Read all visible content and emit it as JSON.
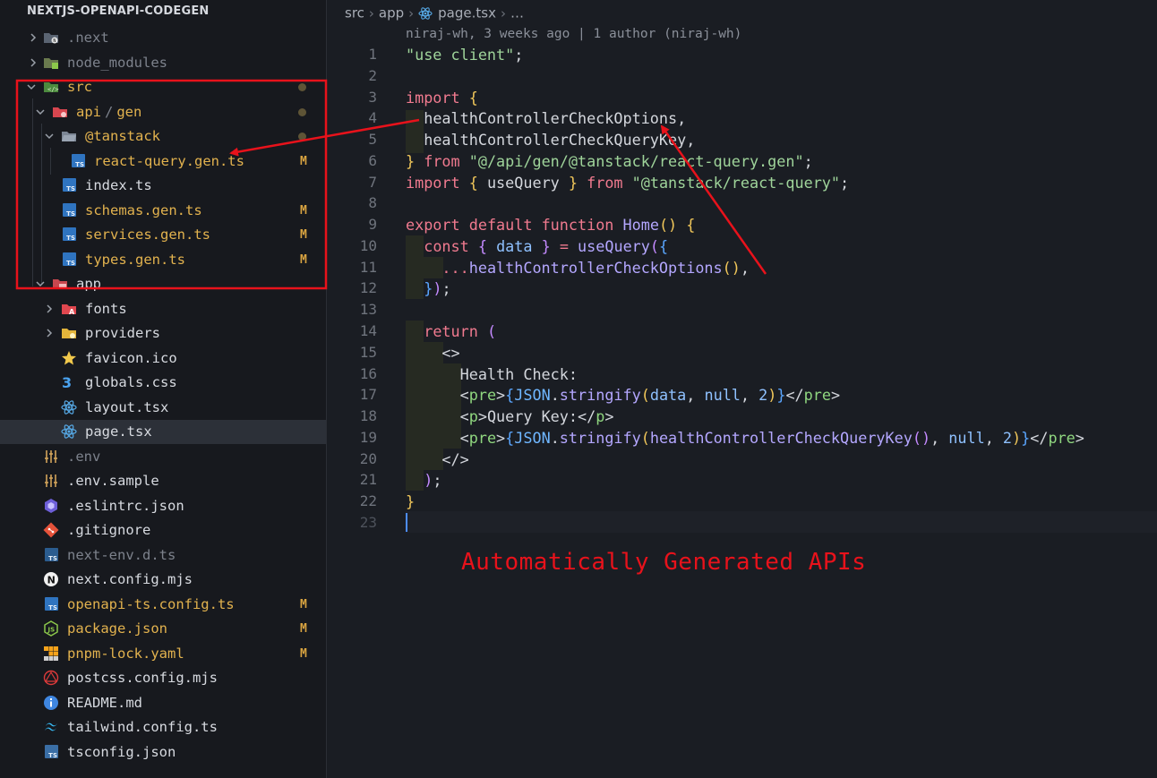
{
  "explorer": {
    "title": "NEXTJS-OPENAPI-CODEGEN",
    "tree": [
      {
        "label": ".next"
      },
      {
        "label": "node_modules"
      },
      {
        "label": "src"
      },
      {
        "label": "api",
        "sep": "/",
        "label2": "gen"
      },
      {
        "label": "@tanstack"
      },
      {
        "label": "react-query.gen.ts",
        "badge": "M"
      },
      {
        "label": "index.ts"
      },
      {
        "label": "schemas.gen.ts",
        "badge": "M"
      },
      {
        "label": "services.gen.ts",
        "badge": "M"
      },
      {
        "label": "types.gen.ts",
        "badge": "M"
      },
      {
        "label": "app"
      },
      {
        "label": "fonts"
      },
      {
        "label": "providers"
      },
      {
        "label": "favicon.ico"
      },
      {
        "label": "globals.css"
      },
      {
        "label": "layout.tsx"
      },
      {
        "label": "page.tsx"
      },
      {
        "label": ".env"
      },
      {
        "label": ".env.sample"
      },
      {
        "label": ".eslintrc.json"
      },
      {
        "label": ".gitignore"
      },
      {
        "label": "next-env.d.ts"
      },
      {
        "label": "next.config.mjs"
      },
      {
        "label": "openapi-ts.config.ts",
        "badge": "M"
      },
      {
        "label": "package.json",
        "badge": "M"
      },
      {
        "label": "pnpm-lock.yaml",
        "badge": "M"
      },
      {
        "label": "postcss.config.mjs"
      },
      {
        "label": "README.md"
      },
      {
        "label": "tailwind.config.ts"
      },
      {
        "label": "tsconfig.json"
      }
    ]
  },
  "editor": {
    "breadcrumb": [
      "src",
      "app",
      "page.tsx",
      "…"
    ],
    "blame": "niraj-wh, 3 weeks ago | 1 author (niraj-wh)",
    "line_numbers": [
      "1",
      "2",
      "3",
      "4",
      "5",
      "6",
      "7",
      "8",
      "9",
      "10",
      "11",
      "12",
      "13",
      "14",
      "15",
      "16",
      "17",
      "18",
      "19",
      "20",
      "21",
      "22",
      "23"
    ],
    "code": {
      "use_client": "\"use client\"",
      "import": "import",
      "from": "from",
      "export": "export",
      "default": "default",
      "function": "function",
      "const": "const",
      "return": "return",
      "null": "null",
      "healthControllerCheckOptions": "healthControllerCheckOptions",
      "healthControllerCheckQueryKey": "healthControllerCheckQueryKey",
      "path_gen": "\"@/api/gen/@tanstack/react-query.gen\"",
      "path_rq": "\"@tanstack/react-query\"",
      "useQuery": "useQuery",
      "home": "Home",
      "data": "data",
      "spread": "...",
      "health_check": "Health Check:",
      "pre": "pre",
      "p": "p",
      "json": "JSON",
      "stringify": "stringify",
      "num2": "2",
      "query_key_text": "Query Key:"
    },
    "annotation": "Automatically Generated APIs"
  },
  "colors": {
    "annotation_red": "#e8121b",
    "modified": "#e2b24e",
    "keyword": "#f07a8f",
    "string": "#9fd49a",
    "function": "#b4a7ff"
  }
}
